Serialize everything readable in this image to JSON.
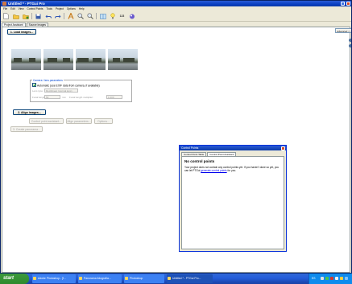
{
  "window": {
    "title": "Untitled * - PTGui Pro"
  },
  "menu": [
    "File",
    "Edit",
    "View",
    "Control Points",
    "Tools",
    "Project",
    "Options",
    "Help"
  ],
  "toolbar_icons": [
    "new-project-icon",
    "open-project-icon",
    "open-recent-icon",
    "save-icon",
    "undo-icon",
    "redo-icon",
    "panorama-editor-icon",
    "zoom-in-icon",
    "zoom-out-icon",
    "control-point-editor-icon",
    "optimizer-icon",
    "number-123-icon",
    "preview-icon"
  ],
  "tabs": [
    "Project Assistant",
    "Source Images"
  ],
  "panel": {
    "load_button": "1. Load images...",
    "advanced": "Advanced <<",
    "fieldset_legend": "Camera / lens parameters",
    "auto_exif": "Automatic (use EXIF data from camera, if available)",
    "lens_type_label": "Lens type:",
    "lens_type_value": "Rectilinear (normal lens)",
    "focal_length_label": "Focal length:",
    "focal_length_value": "50",
    "focal_length_unit": "mm",
    "crop_label": "Focal length multiplier:",
    "crop_value": "1.000",
    "align_button": "2. Align images...",
    "cp_assistant": "Control point assistant...",
    "align_parameters": "Align parameters...",
    "options": "Options...",
    "create_button": "3. Create panorama..."
  },
  "dialog": {
    "title": "Control Points",
    "tabs": [
      "Control Point Table",
      "Control Point Assistant"
    ],
    "heading": "No control points",
    "message_part1": "Your project does not contain any control points yet. If you haven't done so yet, you can let PTGui ",
    "message_link": "generate control points",
    "message_part2": " for you."
  },
  "taskbar": {
    "start": "start",
    "tasks": [
      "Adobe Photoshop - [f...",
      "Panorama fotografía...",
      "Photoshop",
      "Untitled * - PTGui Pro..."
    ],
    "lang": "ES"
  }
}
